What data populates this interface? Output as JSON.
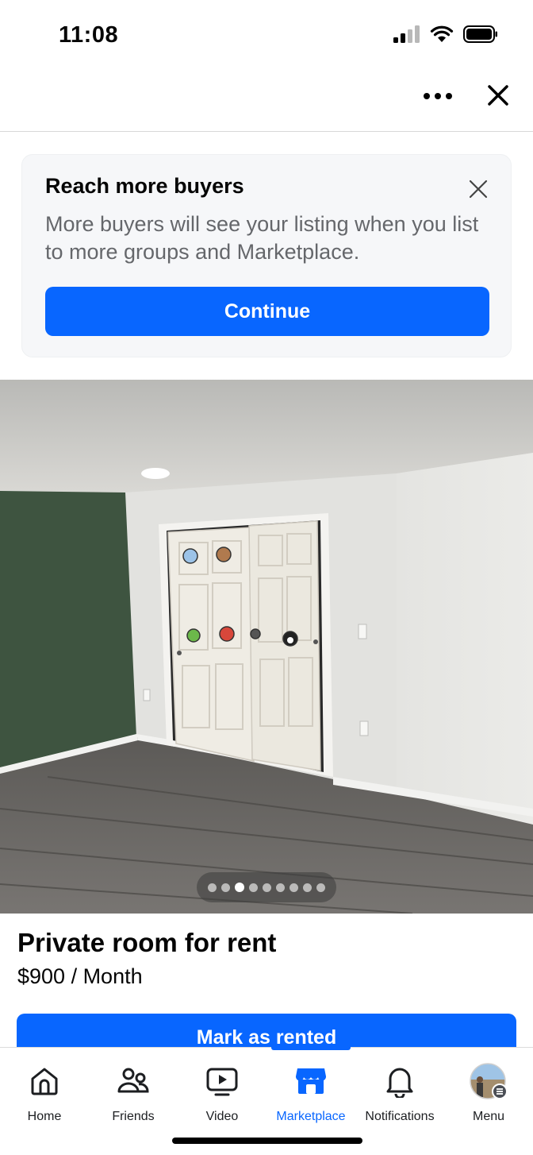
{
  "status_bar": {
    "time": "11:08",
    "icons": [
      "signal-icon",
      "wifi-icon",
      "battery-icon"
    ]
  },
  "top_bar": {
    "icons": [
      "more-icon",
      "close-icon"
    ]
  },
  "promo": {
    "title": "Reach more buyers",
    "body": "More buyers will see your listing when you list to more groups and Marketplace.",
    "continue_label": "Continue"
  },
  "photo": {
    "total_images": 9,
    "current_index": 3
  },
  "listing": {
    "title": "Private room for rent",
    "price": "$900 / Month",
    "mark_rented_label": "Mark as rented"
  },
  "tabs": [
    {
      "label": "Home",
      "icon": "home-icon",
      "active": false
    },
    {
      "label": "Friends",
      "icon": "friends-icon",
      "active": false
    },
    {
      "label": "Video",
      "icon": "video-icon",
      "active": false
    },
    {
      "label": "Marketplace",
      "icon": "marketplace-icon",
      "active": true
    },
    {
      "label": "Notifications",
      "icon": "bell-icon",
      "active": false
    },
    {
      "label": "Menu",
      "icon": "avatar",
      "active": false
    }
  ],
  "colors": {
    "accent": "#0866ff",
    "text_primary": "#050505",
    "text_secondary": "#65676b",
    "card_bg": "#f6f7f9"
  }
}
